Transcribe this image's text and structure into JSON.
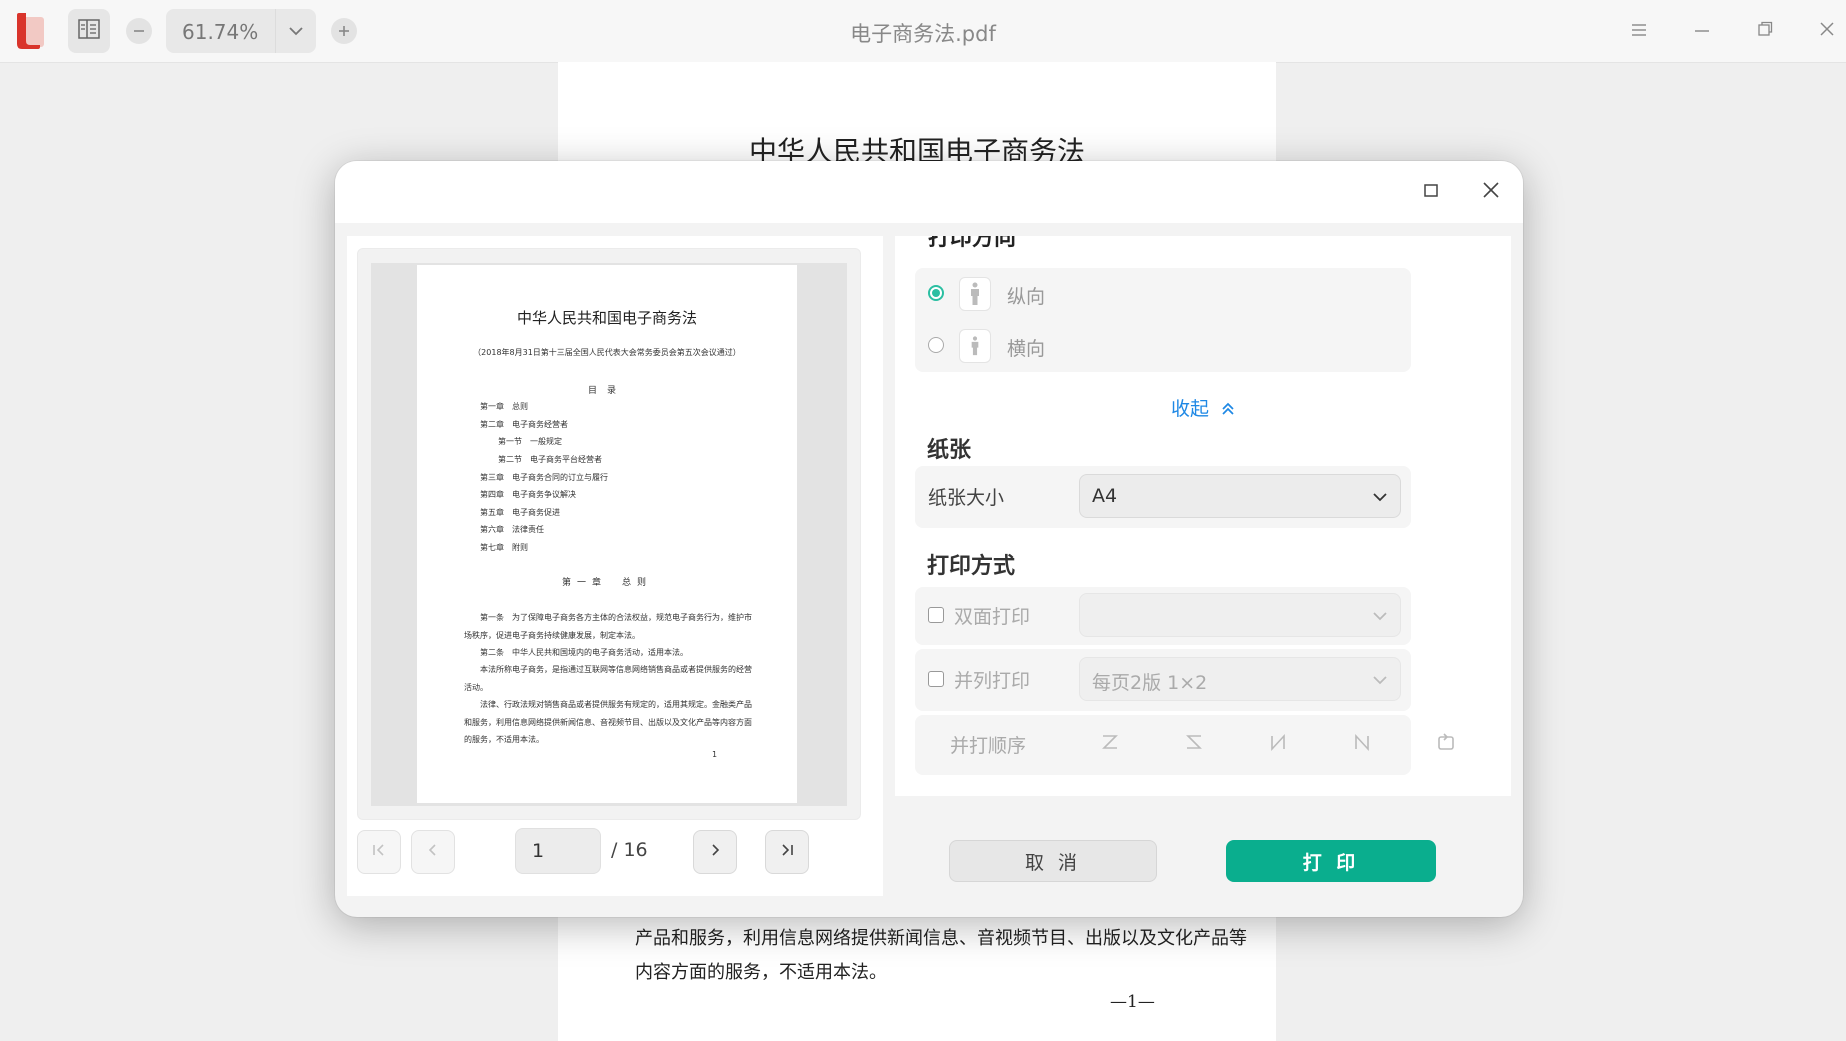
{
  "topbar": {
    "zoom": "61.74%",
    "title": "电子商务法.pdf"
  },
  "document": {
    "heading": "中华人民共和国电子商务法",
    "lines": [
      "产品和服务，利用信息网络提供新闻信息、音视频节目、出版以及文化产品等",
      "内容方面的服务，不适用本法。"
    ],
    "page_number": "—1—"
  },
  "preview": {
    "title": "中华人民共和国电子商务法",
    "subtitle": "（2018年8月31日第十三届全国人民代表大会常务委员会第五次会议通过）",
    "toc_title": "目录",
    "toc": [
      "第一章　总则",
      "第二章　电子商务经营者",
      "第一节　一般规定",
      "第二节　电子商务平台经营者",
      "第三章　电子商务合同的订立与履行",
      "第四章　电子商务争议解决",
      "第五章　电子商务促进",
      "第六章　法律责任",
      "第七章　附则"
    ],
    "chapter1": "第一章　总则",
    "paragraphs": [
      "第一条　为了保障电子商务各方主体的合法权益，规范电子商务行为，维护市场秩序，促进电子商务持续健康发展，制定本法。",
      "第二条　中华人民共和国境内的电子商务活动，适用本法。",
      "本法所称电子商务，是指通过互联网等信息网络销售商品或者提供服务的经营活动。",
      "法律、行政法规对销售商品或者提供服务有规定的，适用其规定。金融类产品和服务，利用信息网络提供新闻信息、音视频节目、出版以及文化产品等内容方面的服务，不适用本法。"
    ],
    "page_num": "1",
    "nav": {
      "current_page": "1",
      "total": "/ 16"
    }
  },
  "settings": {
    "orientation_section_title": "打印方向",
    "orientation": [
      {
        "label": "纵向",
        "selected": true
      },
      {
        "label": "横向",
        "selected": false
      }
    ],
    "collapse_label": "收起",
    "paper": {
      "section_title": "纸张",
      "size_label": "纸张大小",
      "size_value": "A4"
    },
    "print_mode": {
      "section_title": "打印方式",
      "duplex_label": "双面打印",
      "duplex_value": "",
      "nup_label": "并列打印",
      "nup_value": "每页2版 1×2",
      "order_label": "并打顺序"
    }
  },
  "buttons": {
    "cancel": "取 消",
    "print": "打 印"
  },
  "colors": {
    "accent": "#0aae8e",
    "radio": "#2bbfa2",
    "link": "#1e88e5",
    "logo": "#d9342b"
  }
}
